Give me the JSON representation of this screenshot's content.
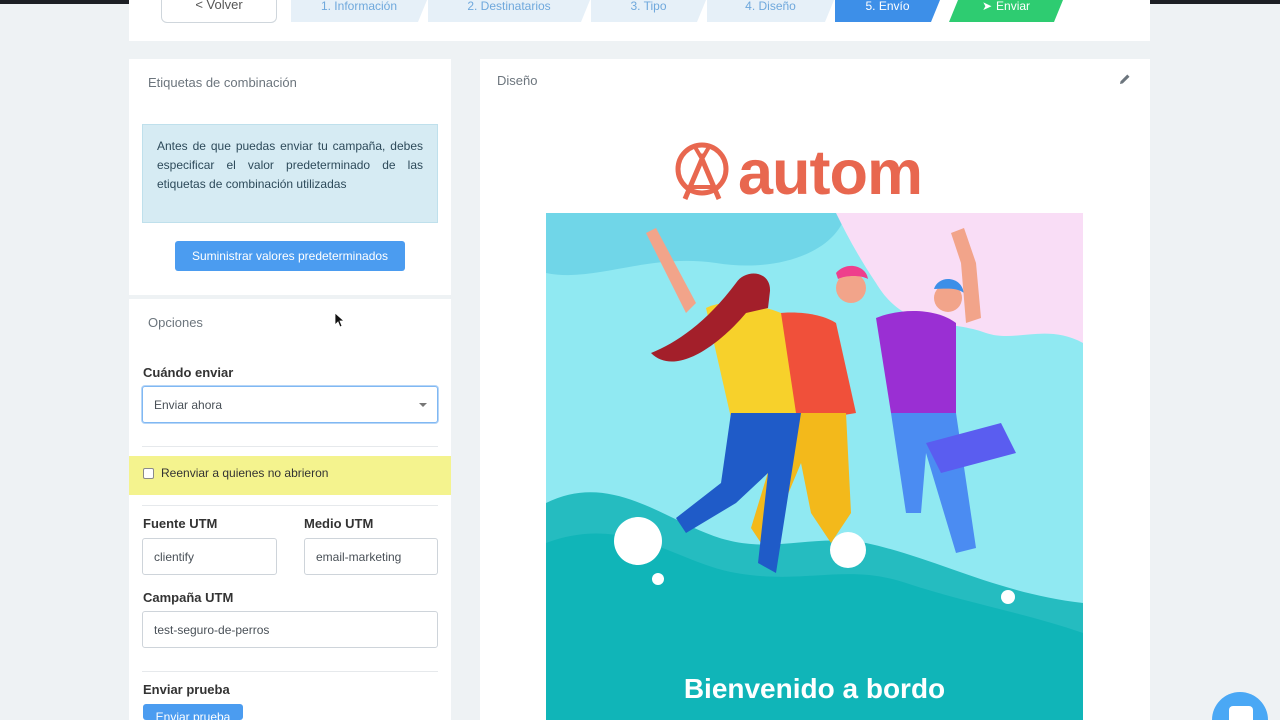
{
  "wizard": {
    "back_label": "< Volver",
    "steps": [
      {
        "label": "1. Información"
      },
      {
        "label": "2. Destinatarios"
      },
      {
        "label": "3. Tipo"
      },
      {
        "label": "4. Diseño"
      },
      {
        "label": "5. Envío"
      },
      {
        "label": "Enviar"
      }
    ]
  },
  "merge_tags": {
    "title": "Etiquetas de combinación",
    "alert_text": "Antes de que puedas enviar tu campaña, debes especificar el valor predeterminado de las etiquetas de combinación utilizadas",
    "supply_button": "Suministrar valores predeterminados"
  },
  "options": {
    "title": "Opciones",
    "when_label": "Cuándo enviar",
    "when_value": "Enviar ahora",
    "resend_label": "Reenviar a quienes no abrieron",
    "utm_source_label": "Fuente UTM",
    "utm_source_value": "clientify",
    "utm_medium_label": "Medio UTM",
    "utm_medium_value": "email-marketing",
    "utm_campaign_label": "Campaña UTM",
    "utm_campaign_value": "test-seguro-de-perros",
    "test_label": "Enviar prueba",
    "test_button": "Enviar prueba"
  },
  "design": {
    "title": "Diseño",
    "brand_name": "autom",
    "hero_headline": "Bienvenido a bordo"
  },
  "colors": {
    "accent": "#4b9cf0",
    "brand": "#e8674f",
    "success": "#2ecc71",
    "highlight": "#f4f38e"
  }
}
